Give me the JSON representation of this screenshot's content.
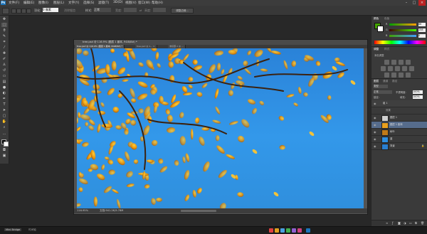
{
  "menubar": {
    "app_icon": "Ps",
    "items": [
      "文件(F)",
      "编辑(E)",
      "图像(I)",
      "图层(L)",
      "文字(Y)",
      "选择(S)",
      "滤镜(T)",
      "3D(D)",
      "视图(V)",
      "窗口(W)",
      "帮助(H)"
    ]
  },
  "options": {
    "feather_label": "羽化:",
    "feather_value": "0 像素",
    "antialias_label": "消除锯齿",
    "style_label": "样式:",
    "style_value": "正常",
    "width_label": "宽度:",
    "height_label": "高度:",
    "refine_edge": "调整边缘..."
  },
  "document": {
    "title": "tree.psd @ 116.9% (图层 1 副本, RGB/8#) *",
    "tabs": [
      "tree.psd @ 116.9% (图层 1 副本, RGB/8#) *",
      "tree.psd @ 1... ×",
      "未标题-1 @ ..."
    ],
    "zoom": "116.95%",
    "doc_info": "文档:941.2K/9.78M"
  },
  "color_panel": {
    "tabs": [
      "颜色",
      "色板"
    ],
    "sliders": [
      {
        "label": "R",
        "value": "66"
      },
      {
        "label": "G",
        "value": "158"
      },
      {
        "label": "B",
        "value": "0"
      }
    ]
  },
  "adjust_panel": {
    "tabs": [
      "调整",
      "样式"
    ],
    "hint": "添加调整"
  },
  "layers_panel": {
    "tabs": [
      "图层",
      "通道",
      "路径"
    ],
    "kind": "类型",
    "blend": "正常",
    "opacity_label": "不透明度:",
    "opacity_value": "100%",
    "lock_label": "锁定:",
    "fill_label": "填充:",
    "fill_value": "100%",
    "layers": [
      {
        "name": "组 1",
        "type": "group"
      },
      {
        "name": "效果",
        "type": "fx"
      },
      {
        "name": "图层 1",
        "type": "layer"
      },
      {
        "name": "图层 1 副本",
        "type": "layer"
      },
      {
        "name": "树叶",
        "type": "layer"
      },
      {
        "name": "蓝",
        "type": "layer"
      },
      {
        "name": "背景",
        "type": "background"
      }
    ]
  },
  "taskbar": {
    "start_label": "Mini Bridge",
    "time_label": "时间轴"
  },
  "colors": {
    "sky": "#3398ea",
    "leaf": "#e89a12",
    "accent": "#1b75bc"
  }
}
